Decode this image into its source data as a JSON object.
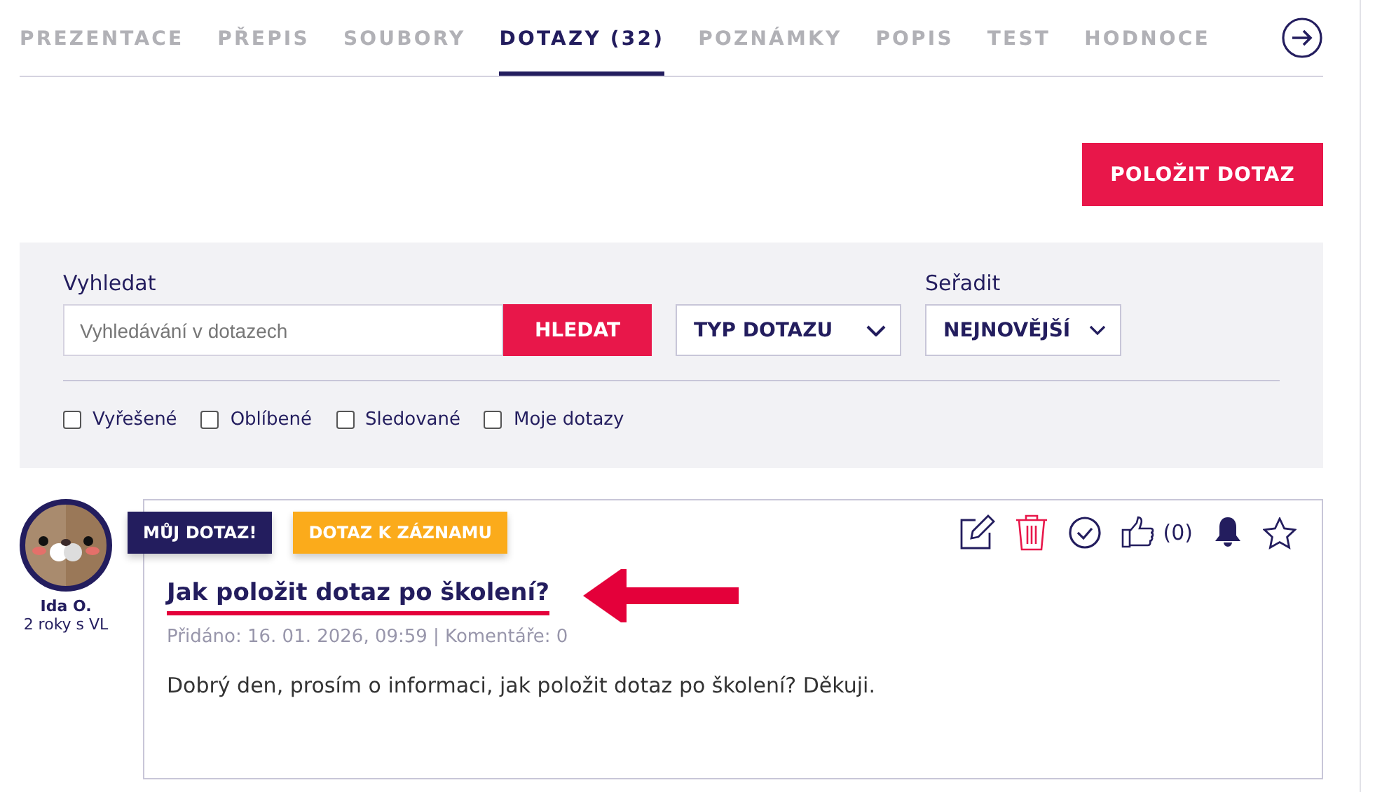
{
  "tabs": [
    {
      "label": "PREZENTACE",
      "selected": false
    },
    {
      "label": "PŘEPIS",
      "selected": false
    },
    {
      "label": "SOUBORY",
      "selected": false
    },
    {
      "label": "DOTAZY (32)",
      "selected": true
    },
    {
      "label": "POZNÁMKY",
      "selected": false
    },
    {
      "label": "POPIS",
      "selected": false
    },
    {
      "label": "TEST",
      "selected": false
    },
    {
      "label": "HODNOCE",
      "selected": false
    }
  ],
  "ask_button": "POLOŽIT DOTAZ",
  "filters": {
    "search_label": "Vyhledat",
    "search": {
      "placeholder": "Vyhledávání v dotazech"
    },
    "search_button": "HLEDAT",
    "type_select": "TYP DOTAZU",
    "sort_label": "Seřadit",
    "sort_select": "NEJNOVĚJŠÍ",
    "checkboxes": [
      {
        "label": "Vyřešené",
        "checked": false
      },
      {
        "label": "Oblíbené",
        "checked": false
      },
      {
        "label": "Sledované",
        "checked": false
      },
      {
        "label": "Moje dotazy",
        "checked": false
      }
    ]
  },
  "question": {
    "author": "Ida O.",
    "tenure": "2 roky s VL",
    "badges": [
      {
        "kind": "mine",
        "text": "MŮJ DOTAZ!"
      },
      {
        "kind": "record",
        "text": "DOTAZ K ZÁZNAMU"
      }
    ],
    "title": "Jak položit dotaz po školení?",
    "meta": "Přidáno: 16. 01. 2026, 09:59 | Komentáře: 0",
    "body": "Dobrý den, prosím o informaci, jak položit dotaz po školení? Děkuji.",
    "likes": "(0)"
  }
}
